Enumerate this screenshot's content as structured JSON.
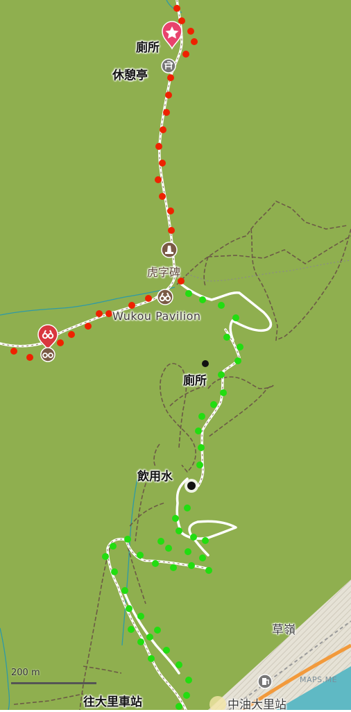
{
  "map": {
    "colors": {
      "land": "#8faf4f",
      "trail_brown": "#6b5a45",
      "trail_white": "#ffffff",
      "red_dots": "#ee2200",
      "green_dots": "#22dd11",
      "water": "#2e9aa6",
      "sea": "#5fb9c4",
      "road_orange": "#f29a3c",
      "poi_pink": "#e8436d",
      "poi_red": "#d9373f",
      "poi_brown": "#7a5a45",
      "poi_grey": "#777777"
    },
    "labels": {
      "toilet_top": "廁所",
      "rest_pavilion": "休憩亭",
      "tiger_stele": "虎字碑",
      "wukou_pavilion": "Wukou Pavilion",
      "toilet_mid": "廁所",
      "drinking_water": "飲用水",
      "caoling": "草嶺",
      "to_dali_station": "往大里車站",
      "cpc_dali": "中油大里站",
      "attribution": "MAPS.ME"
    },
    "scale_bar": "200 m",
    "icons": {
      "toilet_pin": "star-pin-icon",
      "rest_pavilion": "shelter-icon",
      "tiger_stele": "monument-icon",
      "viewpoint_1": "binoculars-icon",
      "viewpoint_2": "binoculars-icon",
      "viewpoint_pin": "binoculars-pin-icon",
      "gas_station": "fuel-icon"
    }
  }
}
